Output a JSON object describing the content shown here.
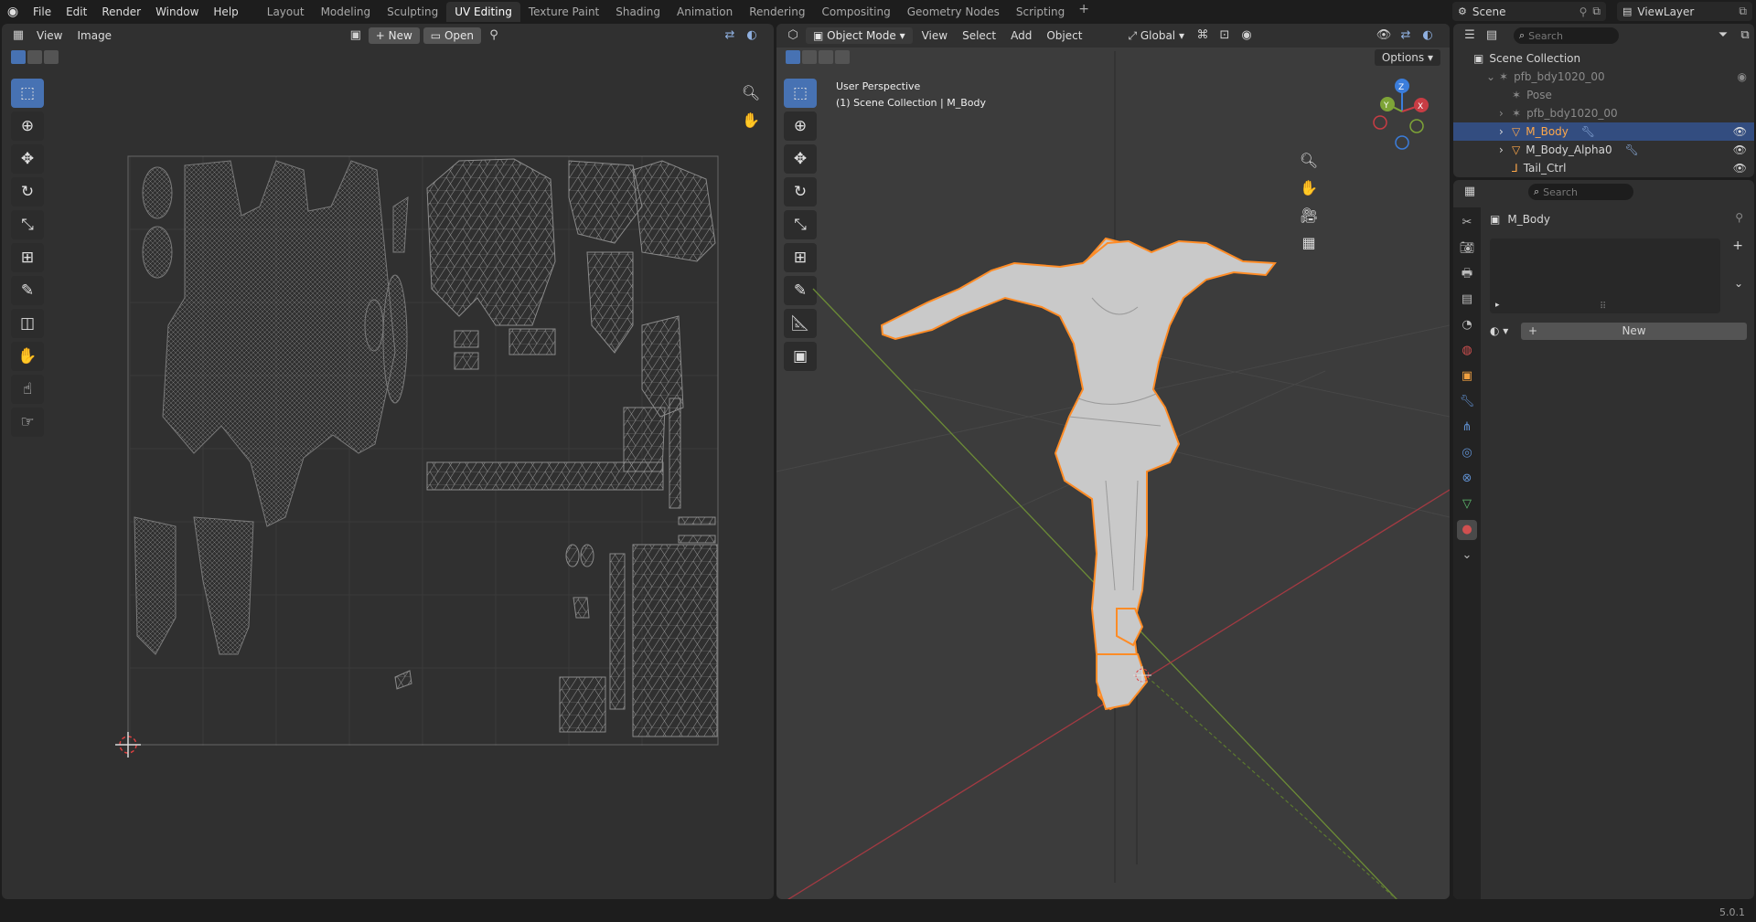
{
  "menu": [
    "File",
    "Edit",
    "Render",
    "Window",
    "Help"
  ],
  "workspaces": [
    "Layout",
    "Modeling",
    "Sculpting",
    "UV Editing",
    "Texture Paint",
    "Shading",
    "Animation",
    "Rendering",
    "Compositing",
    "Geometry Nodes",
    "Scripting"
  ],
  "active_workspace": "UV Editing",
  "scene_name": "Scene",
  "view_layer": "ViewLayer",
  "uv_editor": {
    "menus": [
      "View",
      "Image"
    ],
    "new_label": "New",
    "open_label": "Open"
  },
  "viewport": {
    "mode": "Object Mode",
    "menus": [
      "View",
      "Select",
      "Add",
      "Object"
    ],
    "transform": "Global",
    "options": "Options",
    "overlay_line1": "User Perspective",
    "overlay_line2": "(1) Scene Collection | M_Body"
  },
  "outliner": {
    "search_placeholder": "Search",
    "root": "Scene Collection",
    "items": [
      {
        "label": "pfb_bdy1020_00",
        "dim": true
      },
      {
        "label": "Pose",
        "dim": true
      },
      {
        "label": "pfb_bdy1020_00",
        "dim": true
      },
      {
        "label": "M_Body",
        "dim": false
      },
      {
        "label": "M_Body_Alpha0",
        "dim": false
      },
      {
        "label": "Tail_Ctrl",
        "dim": false
      }
    ]
  },
  "properties": {
    "search_placeholder": "Search",
    "object_name": "M_Body",
    "new_label": "New"
  },
  "gizmo": {
    "x": "X",
    "y": "Y",
    "z": "Z"
  },
  "version": "5.0.1",
  "colors": {
    "accent": "#4772b3",
    "selection_outline": "#ff8c26",
    "x_axis": "#c83c44",
    "y_axis": "#7ea437",
    "z_axis": "#3b7ddb"
  }
}
